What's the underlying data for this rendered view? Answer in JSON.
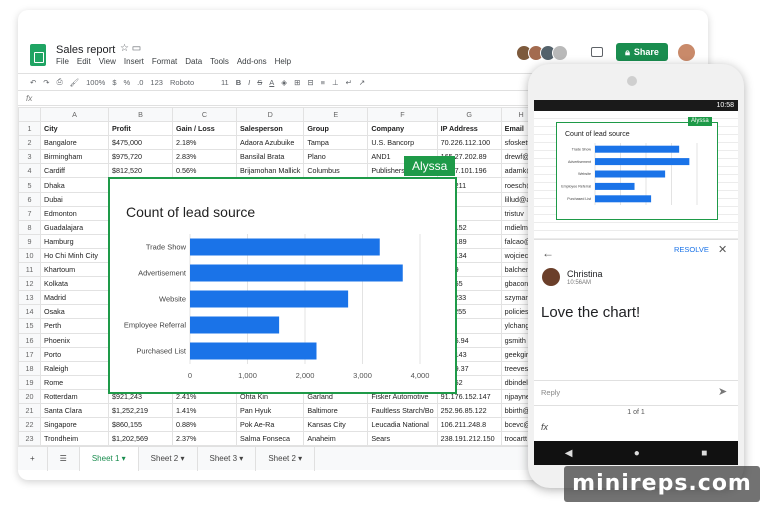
{
  "sheet": {
    "title": "Sales report",
    "menu": [
      "File",
      "Edit",
      "View",
      "Insert",
      "Format",
      "Data",
      "Tools",
      "Add-ons",
      "Help"
    ],
    "share_label": "Share",
    "toolbar": {
      "zoom": "100%",
      "currency": "$",
      "percent": "%",
      "format": "123",
      "font": "Roboto",
      "size": "11"
    },
    "fx": "fx",
    "columns": [
      "",
      "A",
      "B",
      "C",
      "D",
      "E",
      "F",
      "G",
      "H"
    ],
    "headers": [
      "City",
      "Profit",
      "Gain / Loss",
      "Salesperson",
      "Group",
      "Company",
      "IP Address",
      "Email"
    ],
    "rows": [
      [
        "Bangalore",
        "$475,000",
        "2.18%",
        "Adaora Azubuike",
        "Tampa",
        "U.S. Bancorp",
        "70.226.112.100",
        "sfoskett"
      ],
      [
        "Birmingham",
        "$975,720",
        "2.83%",
        "Bansilal Brata",
        "Plano",
        "AND1",
        "165.27.202.89",
        "drewf@"
      ],
      [
        "Cardiff",
        "$812,520",
        "0.56%",
        "Brijamohan Mallick",
        "Columbus",
        "Publishers",
        "20.17.101.196",
        "adamk@"
      ],
      [
        "Dhaka",
        "",
        "",
        "",
        "",
        "",
        "221.211",
        "roesch@"
      ],
      [
        "Dubai",
        "",
        "",
        "",
        "",
        "",
        "",
        "lillud@ac"
      ],
      [
        "Edmonton",
        "",
        "",
        "",
        "",
        "",
        "92.1",
        "tristuv"
      ],
      [
        "Guadalajara",
        "",
        "",
        "",
        "",
        "",
        "220.152",
        "mdielma"
      ],
      [
        "Hamburg",
        "",
        "",
        "",
        "",
        "",
        "139.189",
        "falcao@"
      ],
      [
        "Ho Chi Minh City",
        "",
        "",
        "",
        "",
        "",
        "213.134",
        "wojciech"
      ],
      [
        "Khartoum",
        "",
        "",
        "",
        "",
        "",
        "2.219",
        "balchen"
      ],
      [
        "Kolkata",
        "",
        "",
        "",
        "",
        "",
        "39.255",
        "gbacon@"
      ],
      [
        "Madrid",
        "",
        "",
        "",
        "",
        "",
        "118.233",
        "szymans"
      ],
      [
        "Osaka",
        "",
        "",
        "",
        "",
        "",
        "117.255",
        "policies"
      ],
      [
        "Perth",
        "",
        "",
        "",
        "",
        "",
        "237",
        "ylchang"
      ],
      [
        "Phoenix",
        "",
        "",
        "",
        "",
        "",
        "2.206.94",
        "gsmith"
      ],
      [
        "Porto",
        "",
        "",
        "",
        "",
        "",
        "194.143",
        "geekgirl"
      ],
      [
        "Raleigh",
        "",
        "",
        "",
        "",
        "",
        "1.229.37",
        "treeves"
      ],
      [
        "Rome",
        "",
        "",
        "",
        "",
        "",
        "86.252",
        "dbindel"
      ],
      [
        "Rotterdam",
        "$921,243",
        "2.41%",
        "Ohta Kin",
        "Garland",
        "Fisker Automotive",
        "91.176.152.147",
        "njpayne"
      ],
      [
        "Santa Clara",
        "$1,252,219",
        "1.41%",
        "Pan Hyuk",
        "Baltimore",
        "Faultless Starch/Bo",
        "252.96.85.122",
        "bbirth@"
      ],
      [
        "Singapore",
        "$860,155",
        "0.88%",
        "Pok Ae-Ra",
        "Kansas City",
        "Leucadia National",
        "106.211.248.8",
        "bcevc@"
      ],
      [
        "Trondheim",
        "$1,202,569",
        "2.37%",
        "Salma Fonseca",
        "Anaheim",
        "Sears",
        "238.191.212.150",
        "trocartt"
      ]
    ],
    "tabs": [
      "Sheet 1",
      "Sheet 2",
      "Sheet 3",
      "Sheet 2"
    ],
    "active_tab": 0
  },
  "collaborator_tag": "Alyssa",
  "chart_data": {
    "type": "bar",
    "title": "Count of lead source",
    "categories": [
      "Trade Show",
      "Advertisement",
      "Website",
      "Employee Referral",
      "Purchased List"
    ],
    "values": [
      3300,
      3700,
      2750,
      1550,
      2200
    ],
    "xlim": [
      0,
      4000
    ],
    "xticks": [
      0,
      1000,
      2000,
      3000,
      4000
    ],
    "xtick_labels": [
      "0",
      "1,000",
      "2,000",
      "3,000",
      "4,000"
    ],
    "bar_color": "#1a73e8",
    "grid": true
  },
  "phone": {
    "time": "10:58",
    "resolve_label": "RESOLVE",
    "commenter": "Christina",
    "comment_time": "10:56AM",
    "comment": "Love the chart!",
    "reply_placeholder": "Reply",
    "pager": "1 of 1",
    "fx": "fx",
    "nav": [
      "◀",
      "●",
      "■"
    ]
  },
  "watermark": "minireps.com"
}
